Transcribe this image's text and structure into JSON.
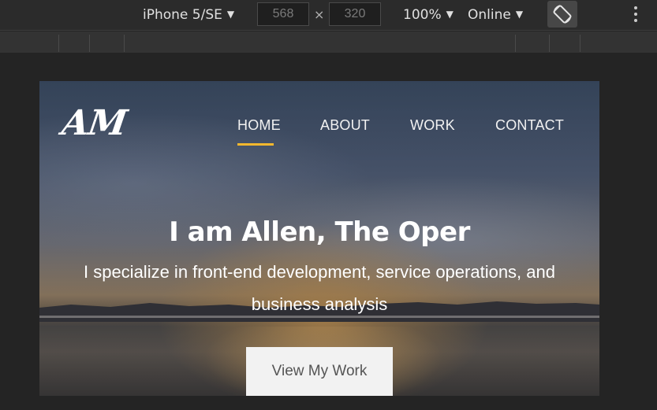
{
  "devtools": {
    "device": "iPhone 5/SE",
    "width": "568",
    "height": "320",
    "times": "×",
    "zoom": "100%",
    "network": "Online",
    "caret": "▼",
    "rotate_icon": "rotate-icon",
    "more_icon": "more-vertical-icon"
  },
  "site": {
    "logo": "AM",
    "nav": [
      {
        "label": "HOME",
        "active": true
      },
      {
        "label": "ABOUT",
        "active": false
      },
      {
        "label": "WORK",
        "active": false
      },
      {
        "label": "CONTACT",
        "active": false
      }
    ],
    "accent_color": "#f5b82e",
    "hero": {
      "title": "I am Allen, The Oper",
      "subtitle_line1": "I specialize in front-end development, service operations, and",
      "subtitle_line2": "business analysis",
      "cta": "View My Work"
    }
  }
}
